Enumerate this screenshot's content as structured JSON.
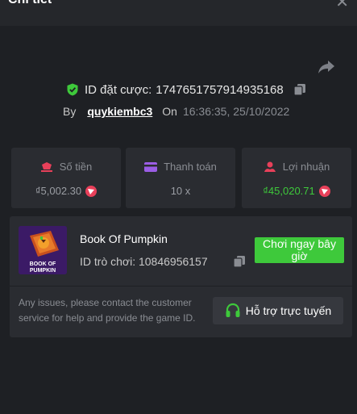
{
  "header": {
    "title": "Chi tiết",
    "close_icon": "close-icon"
  },
  "bet": {
    "id_label": "ID đặt cược:",
    "id_value": "1747651757914935168",
    "by_label": "By",
    "username": "quykiembc3",
    "on_label": "On",
    "timestamp": "16:36:35, 25/10/2022"
  },
  "stats": [
    {
      "label": "Số tiền",
      "value": "₫5,002.30",
      "icon": "money-hand-icon"
    },
    {
      "label": "Thanh toán",
      "value": "10 x",
      "icon": "card-icon"
    },
    {
      "label": "Lợi nhuận",
      "value": "₫45,020.71",
      "icon": "profit-hand-icon"
    }
  ],
  "game": {
    "name": "Book Of Pumpkin",
    "id_label": "ID trò chơi:",
    "id_value": "10846956157",
    "thumb_text": "BOOK OF PUMPKIN",
    "play_label": "Chơi ngay bây giờ"
  },
  "support": {
    "help_text": "Any issues, please contact the customer service for help and provide the game ID.",
    "button_label": "Hỗ trợ trực tuyến"
  },
  "colors": {
    "accent": "#3ec93b",
    "background": "#1e2024",
    "card": "#2a2c31",
    "coin": "#e8405a"
  }
}
